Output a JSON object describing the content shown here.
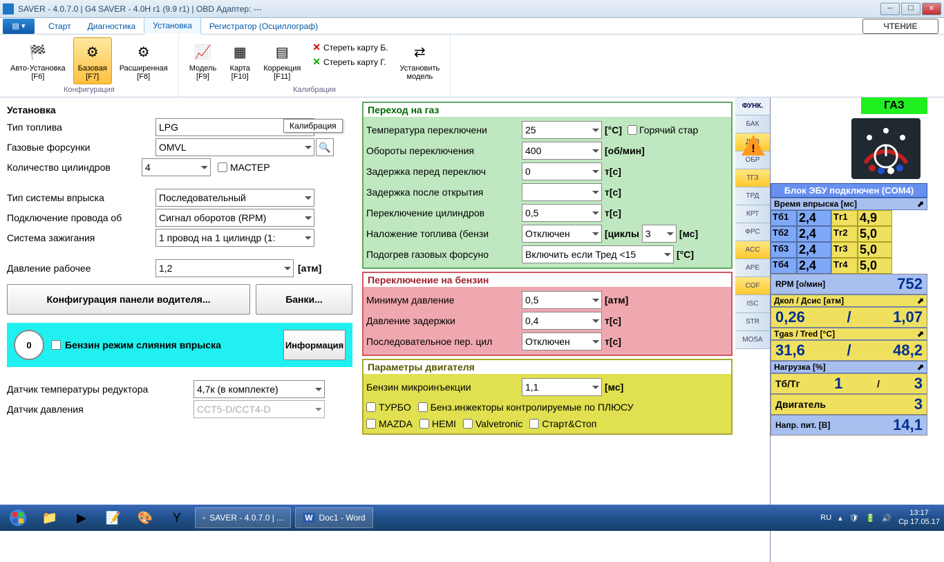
{
  "window": {
    "title": "SAVER - 4.0.7.0  |  G4 SAVER - 4.0H r1 (9.9 r1)  |  OBD Адаптер: ---"
  },
  "tabs": {
    "start": "Старт",
    "diag": "Диагностика",
    "install": "Установка",
    "reg": "Регистратор (Осциллограф)",
    "read_btn": "ЧТЕНИЕ"
  },
  "ribbon": {
    "group1": "Конфигурация",
    "group2": "Калибрация",
    "auto": "Авто-Установка\n[F6]",
    "base": "Базовая\n[F7]",
    "ext": "Расширенная\n[F8]",
    "model": "Модель\n[F9]",
    "map": "Карта\n[F10]",
    "corr": "Коррекция\n[F11]",
    "erase_b": "Стереть карту Б.",
    "erase_g": "Стереть карту Г.",
    "set_model": "Установить\nмодель",
    "tooltip": "Калибрация"
  },
  "install": {
    "title": "Установка",
    "fuel_type_l": "Тип топлива",
    "fuel_type": "LPG",
    "injectors_l": "Газовые форсунки",
    "injectors": "OMVL",
    "cyl_l": "Количество цилиндров",
    "cyl": "4",
    "master": "МАСТЕР",
    "inj_sys_l": "Тип системы впрыска",
    "inj_sys": "Последовательный",
    "rpm_wire_l": "Подключение провода об",
    "rpm_wire": "Сигнал оборотов (RPM)",
    "ign_l": "Система зажигания",
    "ign": "1 провод на 1 цилиндр (1:",
    "press_l": "Давление рабочее",
    "press": "1,2",
    "press_u": "[атм]",
    "driver_panel": "Конфигурация панели водителя...",
    "banks": "Банки...",
    "petrol_merge": "Бензин режим слияния впрыска",
    "info_btn": "Информация",
    "badge": "0",
    "temp_sensor_l": "Датчик температуры редуктора",
    "temp_sensor": "4,7к (в комплекте)",
    "press_sensor_l": "Датчик давления",
    "press_sensor": "CCT5-D/CCT4-D"
  },
  "gas_switch": {
    "title": "Переход на газ",
    "temp_l": "Температура переключени",
    "temp": "25",
    "temp_u": "[°C]",
    "hot": "Горячий стар",
    "rpm_l": "Обороты переключения",
    "rpm": "400",
    "rpm_u": "[об/мин]",
    "delay1_l": "Задержка перед переключ",
    "delay1": "0",
    "delay1_u": "т[с]",
    "delay2_l": "Задержка после открытия",
    "delay2": "",
    "delay2_u": "т[с]",
    "cyl_sw_l": "Переключение цилиндров",
    "cyl_sw": "0,5",
    "cyl_sw_u": "т[с]",
    "overlap_l": "Наложение топлива (бензи",
    "overlap": "Отключен",
    "overlap_u": "[циклы",
    "overlap2": "3",
    "overlap2_u": "[мс]",
    "heat_l": "Подогрев газовых форсуно",
    "heat": "Включить если Тред <15",
    "heat_u": "[°C]"
  },
  "petrol_switch": {
    "title": "Переключение на бензин",
    "min_p_l": "Минимум давление",
    "min_p": "0,5",
    "min_p_u": "[атм]",
    "delay_p_l": "Давление задержки",
    "delay_p": "0,4",
    "delay_p_u": "т[с]",
    "seq_l": "Последовательное пер. цил",
    "seq": "Отключен",
    "seq_u": "т[с]"
  },
  "engine": {
    "title": "Параметры двигателя",
    "microinj_l": "Бензин микроинъекции",
    "microinj": "1,1",
    "microinj_u": "[мс]",
    "turbo": "ТУРБО",
    "plus": "Бенз.инжекторы контролируемые по ПЛЮСУ",
    "mazda": "MAZDA",
    "hemi": "HEMI",
    "valvetronic": "Valvetronic",
    "startstop": "Старт&Стоп"
  },
  "side_tabs": {
    "func": "ФУНК.",
    "bak": "БАК",
    "dav": "ДАВ",
    "obr": "ОБР",
    "tgz": "ТГЗ",
    "trd": "ТРД",
    "krt": "КРТ",
    "frs": "ФРС",
    "acc": "ACC",
    "ape": "APE",
    "cof": "COF",
    "isc": "ISC",
    "str": "STR",
    "mosa": "MOSA"
  },
  "readings": {
    "gas_mode": "ГАЗ",
    "ecu": "Блок ЭБУ подключен (COM4)",
    "inj_title": "Время впрыска [мс]",
    "tb": [
      "Тб1",
      "Тб2",
      "Тб3",
      "Тб4"
    ],
    "tbv": [
      "2,4",
      "2,4",
      "2,4",
      "2,4"
    ],
    "tg": [
      "Тг1",
      "Тг2",
      "Тг3",
      "Тг4"
    ],
    "tgv": [
      "4,9",
      "5,0",
      "5,0",
      "5,0"
    ],
    "rpm_l": "RPM [о/мин]",
    "rpm": "752",
    "press_l": "Дкол / Дсис [атм]",
    "dkol": "0,26",
    "dsis": "1,07",
    "temp_l": "Tgas / Tred [°C]",
    "tgas": "31,6",
    "tred": "48,2",
    "load_l": "Нагрузка [%]",
    "tbtg_l": "Тб/Тг",
    "tbtg_a": "1",
    "tbtg_b": "3",
    "eng_l": "Двигатель",
    "eng_v": "3",
    "volt_l": "Напр. пит. [В]",
    "volt": "14,1"
  },
  "taskbar": {
    "lang": "RU",
    "time": "13:17",
    "date": "Ср 17.05.17",
    "task1": "SAVER - 4.0.7.0 | ...",
    "task2": "Doc1 - Word"
  }
}
